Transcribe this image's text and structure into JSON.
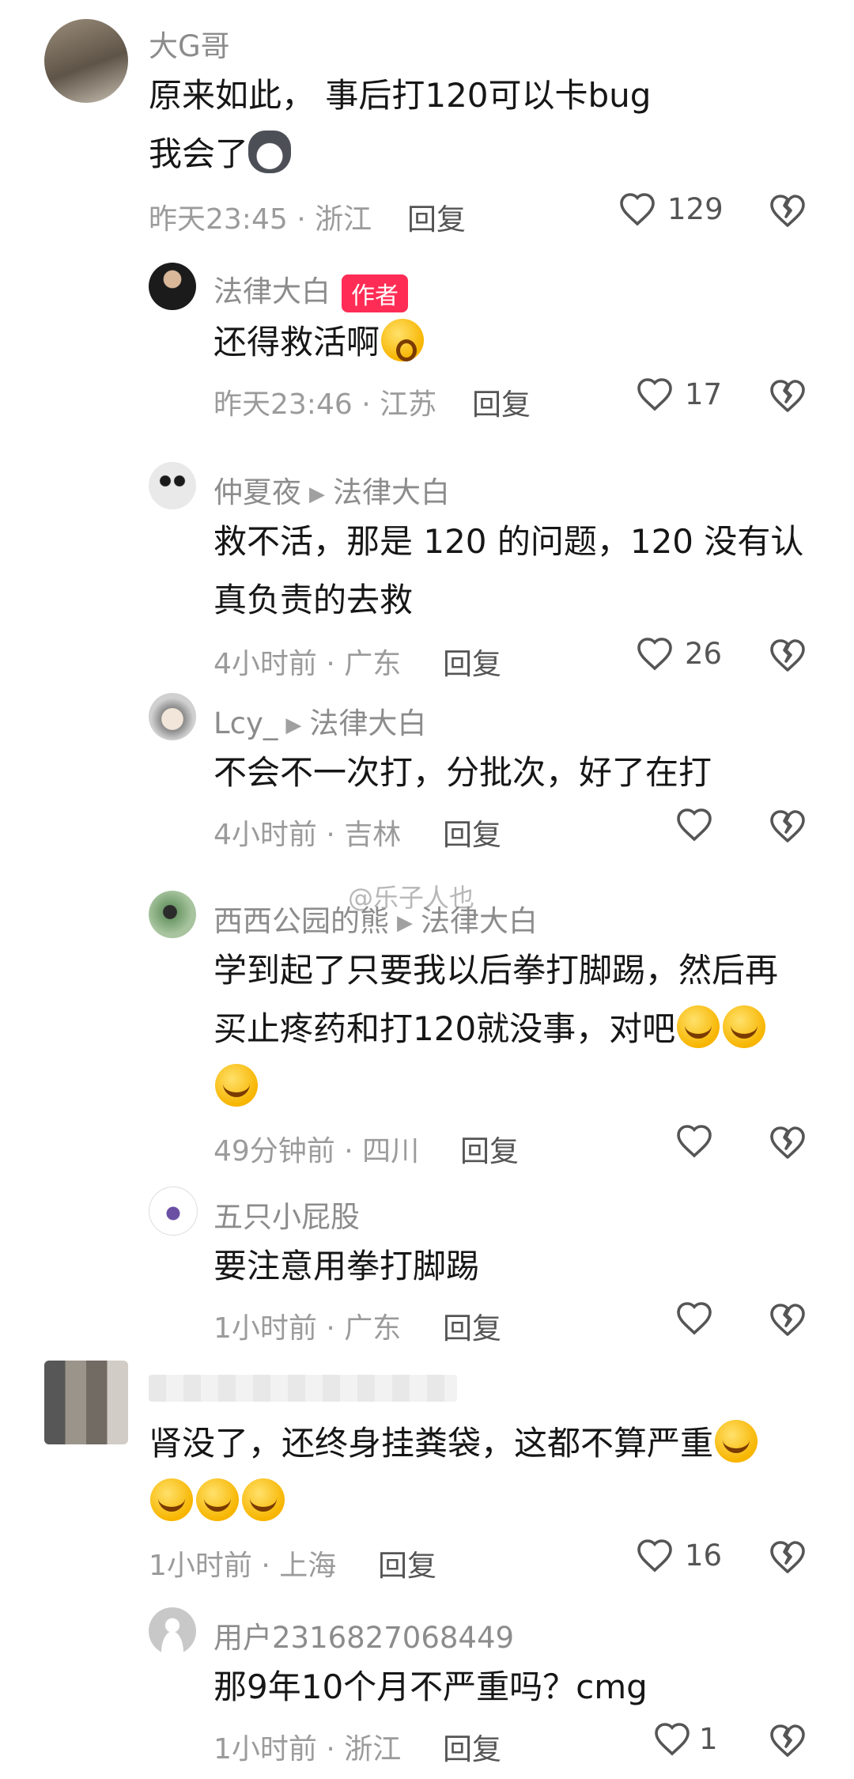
{
  "watermark": "@乐子人也",
  "comments": [
    {
      "name": "大G哥",
      "lines": [
        "原来如此， 事后打120可以卡bug",
        "我会了"
      ],
      "time": "昨天23:45 · 浙江",
      "reply": "回复",
      "likes": "129"
    },
    {
      "name": "法律大白",
      "badge": "作者",
      "lines": [
        "还得救活啊"
      ],
      "time": "昨天23:46 · 江苏",
      "reply": "回复",
      "likes": "17"
    },
    {
      "name": "仲夏夜",
      "reply_to": "法律大白",
      "lines": [
        "救不活，那是 120 的问题，120 没有认",
        "真负责的去救"
      ],
      "time": "4小时前 · 广东",
      "reply": "回复",
      "likes": "26"
    },
    {
      "name": "Lcy_",
      "reply_to": "法律大白",
      "lines": [
        "不会不一次打，分批次，好了在打"
      ],
      "time": "4小时前 · 吉林",
      "reply": "回复",
      "likes": ""
    },
    {
      "name": "西西公园的熊",
      "reply_to": "法律大白",
      "lines": [
        "学到起了只要我以后拳打脚踢，然后再",
        "买止疼药和打120就没事，对吧"
      ],
      "time": "49分钟前 · 四川",
      "reply": "回复",
      "likes": ""
    },
    {
      "name": "五只小屁股",
      "lines": [
        "要注意用拳打脚踢"
      ],
      "time": "1小时前 · 广东",
      "reply": "回复",
      "likes": ""
    },
    {
      "name": "",
      "lines": [
        "肾没了，还终身挂粪袋，这都不算严重"
      ],
      "time": "1小时前 · 上海",
      "reply": "回复",
      "likes": "16"
    },
    {
      "name": "用户2316827068449",
      "lines": [
        "那9年10个月不严重吗？cmg"
      ],
      "time": "1小时前 · 浙江",
      "reply": "回复",
      "likes": "1"
    }
  ]
}
